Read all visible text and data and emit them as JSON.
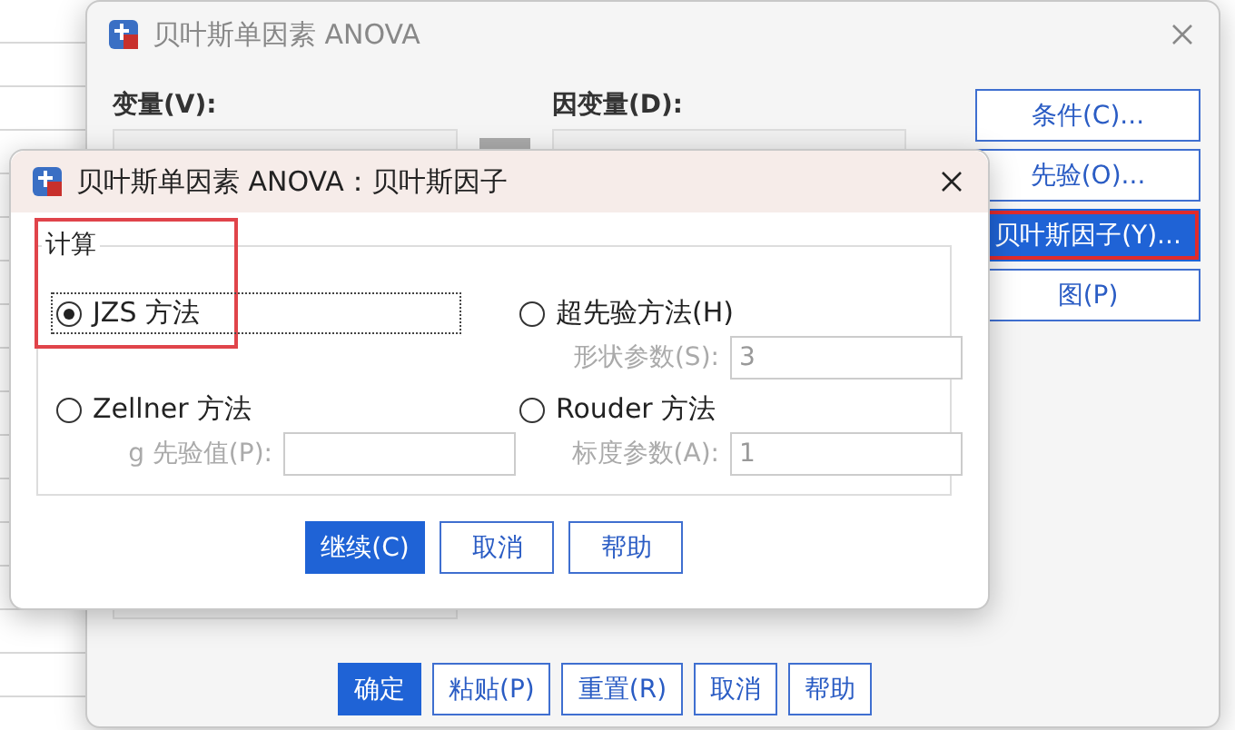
{
  "main_window": {
    "title": "贝叶斯单因素 ANOVA",
    "variables_label": "变量(V):",
    "dependent_label": "因变量(D):",
    "side_buttons": [
      {
        "label": "条件(C)...",
        "selected": false,
        "highlighted": false
      },
      {
        "label": "先验(O)...",
        "selected": false,
        "highlighted": false
      },
      {
        "label": "贝叶斯因子(Y)...",
        "selected": true,
        "highlighted": true
      },
      {
        "label": "图(P)",
        "selected": false,
        "highlighted": false
      }
    ],
    "buttons": [
      {
        "label": "确定",
        "primary": true
      },
      {
        "label": "粘贴(P)",
        "primary": false
      },
      {
        "label": "重置(R)",
        "primary": false
      },
      {
        "label": "取消",
        "primary": false
      },
      {
        "label": "帮助",
        "primary": false
      }
    ]
  },
  "dialog": {
    "title": "贝叶斯单因素 ANOVA：贝叶斯因子",
    "group_label": "计算",
    "group_highlighted": true,
    "methods": [
      {
        "label": "JZS 方法",
        "selected": true
      },
      {
        "label": "超先验方法(H)",
        "selected": false,
        "param_label": "形状参数(S):",
        "param_value": "3",
        "disabled": true
      },
      {
        "label": "Zellner 方法",
        "selected": false,
        "param_label": "g 先验值(P):",
        "disabled": true
      },
      {
        "label": "Rouder 方法",
        "selected": false,
        "param_label": "标度参数(A):",
        "param_value": "1",
        "disabled": true
      }
    ],
    "buttons": [
      {
        "label": "继续(C)",
        "primary": true
      },
      {
        "label": "取消",
        "primary": false
      },
      {
        "label": "帮助",
        "primary": false
      }
    ]
  }
}
